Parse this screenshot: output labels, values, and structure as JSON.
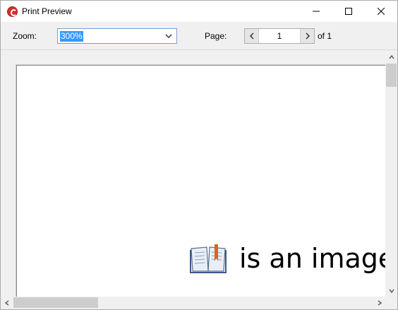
{
  "window": {
    "title": "Print Preview",
    "icon": "app-logo-icon"
  },
  "toolbar": {
    "zoom_label": "Zoom:",
    "zoom_value": "300%",
    "page_label": "Page:",
    "page_value": "1",
    "page_total": "of 1"
  },
  "preview": {
    "text": "is an image",
    "icon": "open-book-icon"
  },
  "colors": {
    "selection": "#3399ff",
    "accent_icon": "#d32f2f"
  }
}
